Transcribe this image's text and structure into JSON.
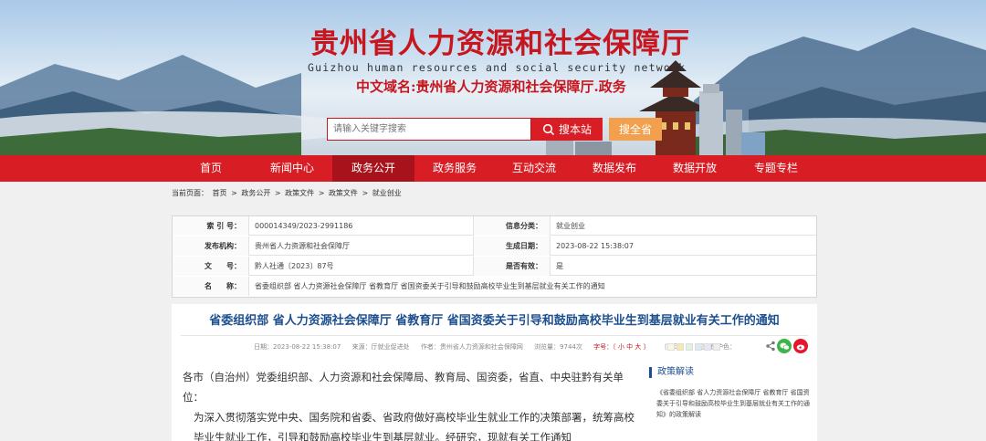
{
  "header": {
    "title": "贵州省人力资源和社会保障厅",
    "subtitle": "Guizhou human resources and social security network",
    "domain": "中文域名:贵州省人力资源和社会保障厅.政务"
  },
  "search": {
    "placeholder": "请输入关键字搜索",
    "button_label": "搜本站",
    "province_label": "搜全省"
  },
  "nav": {
    "items": [
      {
        "label": "首页"
      },
      {
        "label": "新闻中心"
      },
      {
        "label": "政务公开"
      },
      {
        "label": "政务服务"
      },
      {
        "label": "互动交流"
      },
      {
        "label": "数据发布"
      },
      {
        "label": "数据开放"
      },
      {
        "label": "专题专栏"
      }
    ]
  },
  "breadcrumb": {
    "prefix": "当前页面：",
    "items": [
      "首页",
      "政务公开",
      "政策文件",
      "政策文件",
      "就业创业"
    ],
    "separator": ">"
  },
  "info": {
    "index_label": "索 引 号：",
    "index_value": "000014349/2023-2991186",
    "category_label": "信息分类：",
    "category_value": "就业创业",
    "publisher_label": "发布机构：",
    "publisher_value": "贵州省人力资源和社会保障厅",
    "date_label": "生成日期：",
    "date_value": "2023-08-22 15:38:07",
    "docno_label": "文　　号：",
    "docno_value": "黔人社通〔2023〕87号",
    "valid_label": "是否有效：",
    "valid_value": "是",
    "name_label": "名　　称：",
    "name_value": "省委组织部 省人力资源社会保障厅 省教育厅 省国资委关于引导和鼓励高校毕业生到基层就业有关工作的通知"
  },
  "article": {
    "title": "省委组织部 省人力资源社会保障厅 省教育厅 省国资委关于引导和鼓励高校毕业生到基层就业有关工作的通知",
    "meta_date": "日期：2023-08-22 15:38:07",
    "meta_source": "来源：厅就业促进处",
    "meta_author": "作者：贵州省人力资源和社会保障网",
    "meta_views": "浏览量：9744次",
    "meta_font": "字号：〔 小 中 大 〕",
    "meta_print": "〔打印〕",
    "meta_eye": "视力保护色：",
    "swatch_colors": [
      "#fdf6e3",
      "#f6e8a6",
      "#e3f2dc",
      "#dbe8f6",
      "#ece3f6",
      "#eeeeee"
    ],
    "paragraphs": [
      "各市（自治州）党委组织部、人力资源和社会保障局、教育局、国资委，省直、中央驻黔有关单位：",
      "为深入贯彻落实党中央、国务院和省委、省政府做好高校毕业生就业工作的决策部署，统筹高校毕业生就业工作，引导和鼓励高校毕业生到基层就业。经研究，现就有关工作通知"
    ]
  },
  "sidebar": {
    "title": "政策解读",
    "link": "《省委组织部 省人力资源社会保障厅 省教育厅 省国资委关于引导和鼓励高校毕业生到基层就业有关工作的通知》的政策解读"
  },
  "colors": {
    "brand_red": "#d81e24",
    "nav_active": "#a8121a",
    "title_blue": "#1d4f8f",
    "province_orange": "#f2a04d"
  }
}
